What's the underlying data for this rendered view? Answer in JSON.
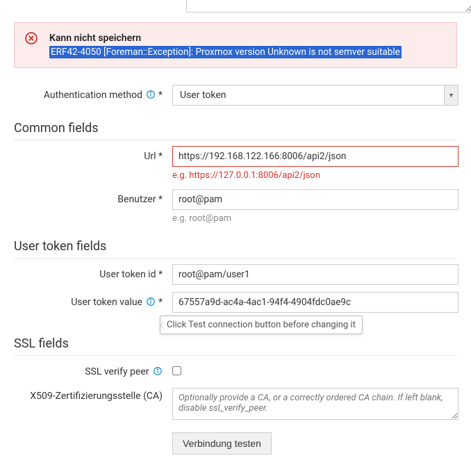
{
  "alert": {
    "title": "Kann nicht speichern",
    "message": "ERF42-4050 [Foreman::Exception]: Proxmox version Unknown is not semver suitable"
  },
  "auth": {
    "label": "Authentication method",
    "required": "*",
    "value": "User token"
  },
  "sections": {
    "common": "Common fields",
    "user_token": "User token fields",
    "ssl": "SSL fields"
  },
  "url": {
    "label": "Url",
    "required": "*",
    "value": "https://192.168.122.166:8006/api2/json",
    "hint": "e.g. https://127.0.0.1:8006/api2/json"
  },
  "user": {
    "label": "Benutzer",
    "required": "*",
    "value": "root@pam",
    "hint": "e.g. root@pam"
  },
  "token_id": {
    "label": "User token id",
    "required": "*",
    "value": "root@pam/user1"
  },
  "token_value": {
    "label": "User token value",
    "required": "*",
    "value": "67557a9d-ac4a-4ac1-94f4-4904fdc0ae9c",
    "tooltip": "Click Test connection button before changing it"
  },
  "ssl_verify": {
    "label": "SSL verify peer"
  },
  "ca": {
    "label": "X509-Zertifizierungsstelle (CA)",
    "placeholder": "Optionally provide a CA, or a correctly ordered CA chain. If left blank, disable ssl_verify_peer."
  },
  "test_btn": {
    "label": "Verbindung testen"
  }
}
